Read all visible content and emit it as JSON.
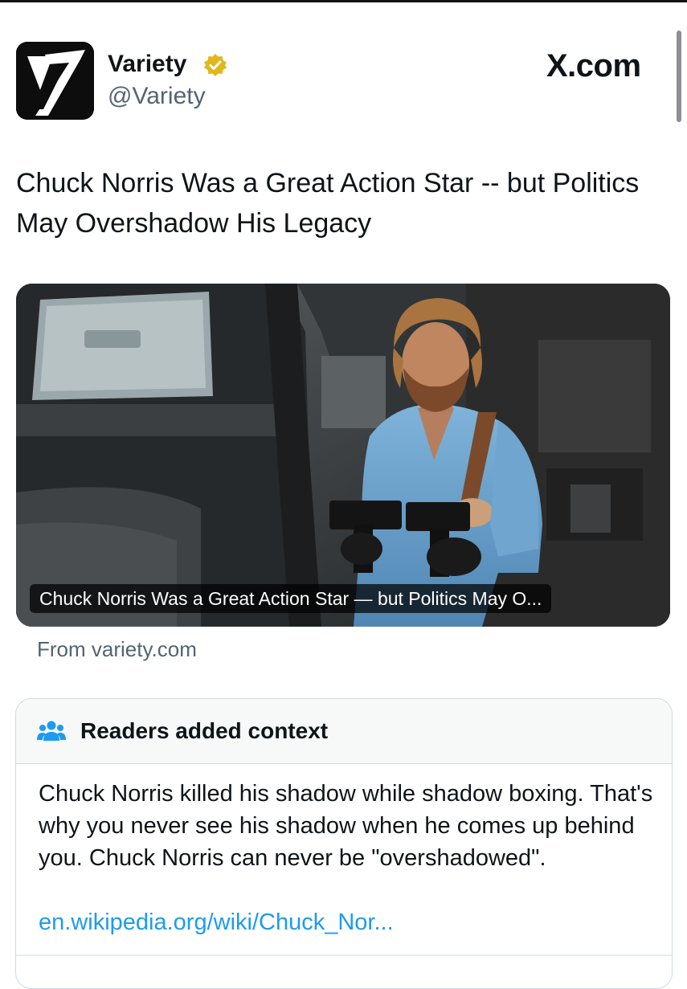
{
  "author": {
    "name": "Variety",
    "handle": "@Variety",
    "logo_letter": "V",
    "verified_badge_color": "#e2b719"
  },
  "site_tag": "X.com",
  "tweet": {
    "text": "Chuck Norris Was a Great Action Star -- but Politics May Overshadow His Legacy"
  },
  "card": {
    "caption": "Chuck Norris Was a Great Action Star — but Politics May O...",
    "source": "From variety.com"
  },
  "context_note": {
    "icon": "readers-icon",
    "title": "Readers added context",
    "body": "Chuck Norris killed his shadow while shadow boxing. That's why you never see his shadow when he comes up behind you. Chuck Norris can never be \"overshadowed\".",
    "link": "en.wikipedia.org/wiki/Chuck_Nor...",
    "link_color": "#1d9bf0"
  }
}
